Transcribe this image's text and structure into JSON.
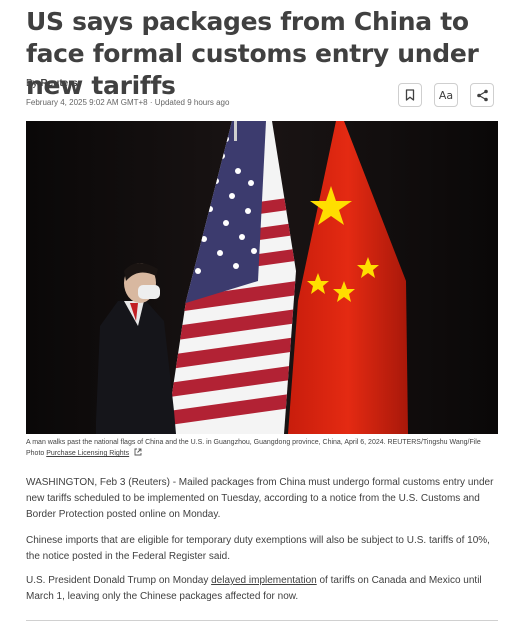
{
  "article": {
    "headline": "US says packages from China to face formal customs entry under new tariffs",
    "byline_prefix": "By ",
    "author": "Reuters",
    "date": "February 4, 2025 9:02 AM GMT+8 · Updated 9 hours ago"
  },
  "toolbar": {
    "bookmark_icon": "bookmark-icon",
    "text_size_label": "Aa",
    "share_icon": "share-icon"
  },
  "image": {
    "description_icons": [
      "us-flag",
      "china-flag",
      "man-with-mask"
    ],
    "caption": "A man walks past the national flags of China and the U.S. in Guangzhou, Guangdong province, China, April 6, 2024. REUTERS/Tingshu Wang/File Photo ",
    "licensing_link": "Purchase Licensing Rights",
    "external_icon": "external-link-icon"
  },
  "body": {
    "p1": "WASHINGTON, Feb 3 (Reuters) - Mailed packages from China must undergo formal customs entry under new tariffs scheduled to be implemented on Tuesday, according to a notice from the U.S. Customs and Border Protection posted online on Monday.",
    "p2": "Chinese imports that are eligible for temporary duty exemptions will also be subject to U.S. tariffs of 10%, the notice posted in the Federal Register said.",
    "p3_before": "U.S. President Donald Trump on Monday ",
    "p3_link": "delayed implementation",
    "p3_after": " of tariffs on Canada and Mexico until March 1, leaving only the Chinese packages affected for now."
  },
  "colors": {
    "text": "#404040",
    "china_red": "#de2910",
    "star_yellow": "#ffde00",
    "us_red": "#b22234",
    "us_blue": "#3c3b6e"
  }
}
